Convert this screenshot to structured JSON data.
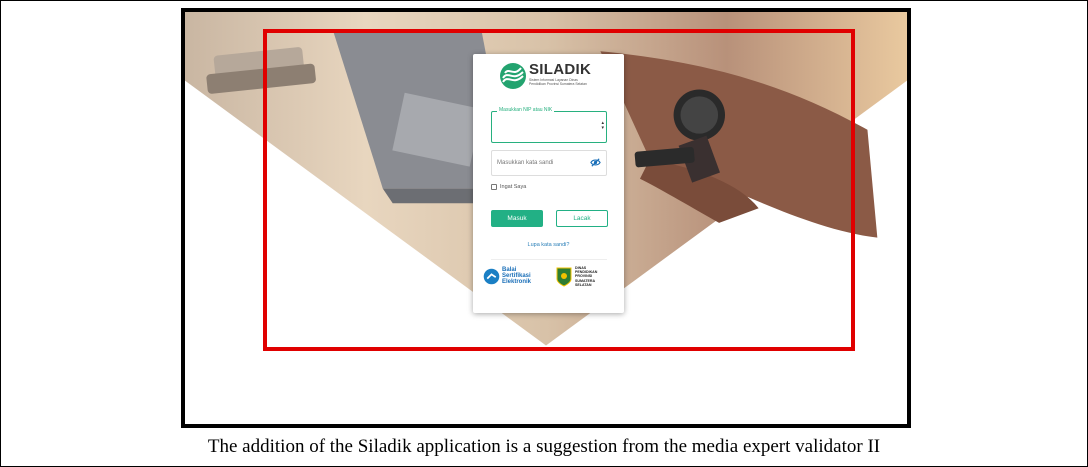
{
  "login": {
    "app_name": "SILADIK",
    "app_subtitle": "Sistem Informasi Layanan Dinas Pendidikan Provinsi Sumatera Selatan",
    "nip_label": "Masukkan NIP atau NIK",
    "password_placeholder": "Masukkan kata sandi",
    "remember_label": "Ingat Saya",
    "login_button": "Masuk",
    "track_button": "Lacak",
    "forgot_link": "Lupa kata sandi?",
    "bsre_text": [
      "Balai",
      "Sertifikasi",
      "Elektronik"
    ],
    "dinas_text": [
      "DINAS",
      "PENDIDIKAN",
      "PROVINSI",
      "SUMATERA",
      "SELATAN"
    ]
  },
  "caption": "The addition of the Siladik application is a suggestion from the media expert validator II",
  "colors": {
    "accent": "#22b085",
    "link": "#2a7fb8",
    "highlight": "#e00000"
  }
}
